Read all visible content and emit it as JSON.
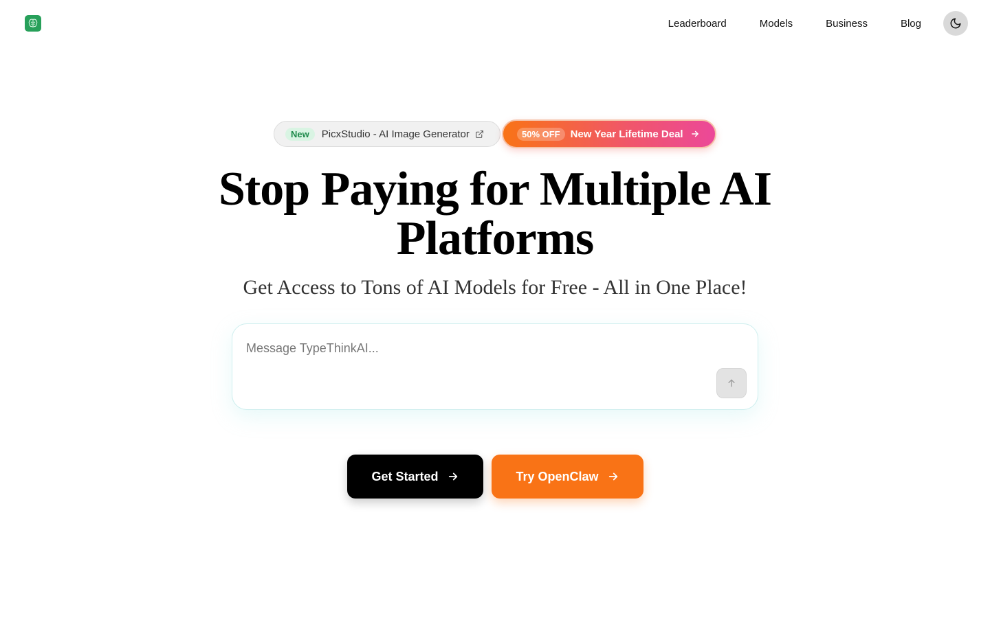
{
  "header": {
    "nav": [
      "Leaderboard",
      "Models",
      "Business",
      "Blog"
    ]
  },
  "promo": {
    "new_badge": "New",
    "new_text": "PicxStudio - AI Image Generator",
    "deal_badge": "50% OFF",
    "deal_text": "New Year Lifetime Deal"
  },
  "hero": {
    "title_line1": "Stop Paying for Multiple AI",
    "title_line2": "Platforms",
    "subtitle": "Get Access to Tons of AI Models for Free - All in One Place!"
  },
  "chat": {
    "placeholder": "Message TypeThinkAI..."
  },
  "cta": {
    "get_started": "Get Started",
    "try_openclaw": "Try OpenClaw"
  },
  "colors": {
    "brand_green": "#27a05a",
    "orange": "#f97316",
    "pink": "#ec4899"
  }
}
